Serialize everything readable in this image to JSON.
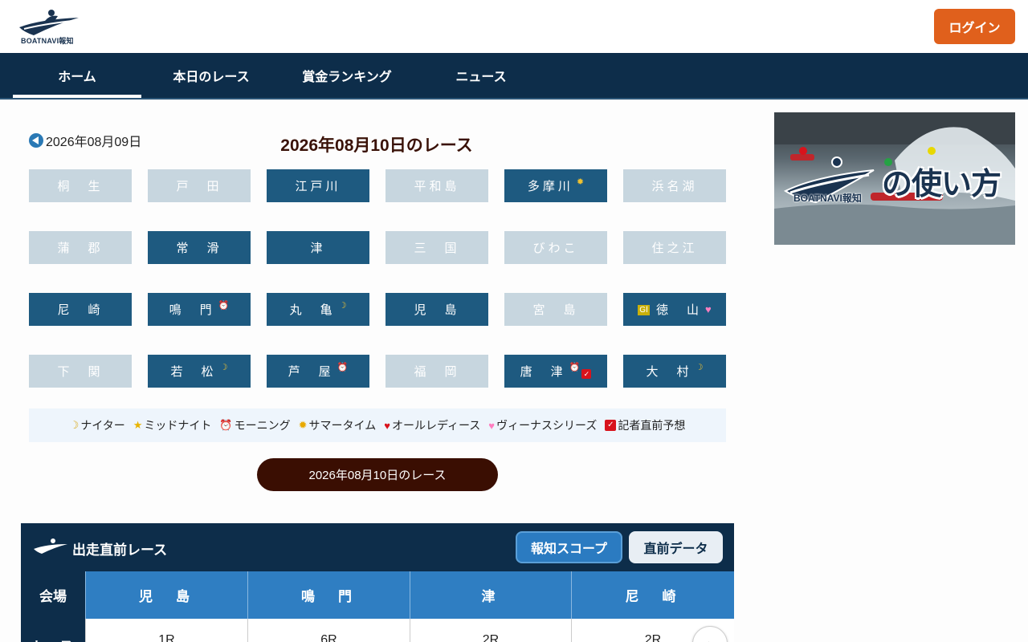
{
  "header": {
    "logo_text": "BOATNAVI報知",
    "login_label": "ログイン"
  },
  "nav": {
    "items": [
      {
        "label": "ホーム",
        "active": true
      },
      {
        "label": "本日のレース",
        "active": false
      },
      {
        "label": "賞金ランキング",
        "active": false
      },
      {
        "label": "ニュース",
        "active": false
      }
    ]
  },
  "date_nav": {
    "prev_date": "2026年08月09日",
    "title": "2026年08月10日のレース"
  },
  "venues": [
    {
      "name": "桐　生",
      "active": false
    },
    {
      "name": "戸　田",
      "active": false
    },
    {
      "name": "江戸川",
      "active": true
    },
    {
      "name": "平和島",
      "active": false
    },
    {
      "name": "多摩川",
      "active": true,
      "marks": [
        "summertime"
      ]
    },
    {
      "name": "浜名湖",
      "active": false
    },
    {
      "name": "蒲　郡",
      "active": false
    },
    {
      "name": "常　滑",
      "active": true
    },
    {
      "name": "津",
      "active": true
    },
    {
      "name": "三　国",
      "active": false
    },
    {
      "name": "びわこ",
      "active": false
    },
    {
      "name": "住之江",
      "active": false
    },
    {
      "name": "尼　崎",
      "active": true
    },
    {
      "name": "鳴　門",
      "active": true,
      "marks": [
        "morning"
      ]
    },
    {
      "name": "丸　亀",
      "active": true,
      "marks": [
        "nighter"
      ]
    },
    {
      "name": "児　島",
      "active": true
    },
    {
      "name": "宮　島",
      "active": false
    },
    {
      "name": "徳　山",
      "active": true,
      "grade": "GⅠ",
      "marks": [
        "venus"
      ]
    },
    {
      "name": "下　関",
      "active": false
    },
    {
      "name": "若　松",
      "active": true,
      "marks": [
        "nighter"
      ]
    },
    {
      "name": "芦　屋",
      "active": true,
      "marks": [
        "morning"
      ]
    },
    {
      "name": "福　岡",
      "active": false
    },
    {
      "name": "唐　津",
      "active": true,
      "marks": [
        "morning",
        "reporter"
      ]
    },
    {
      "name": "大　村",
      "active": true,
      "marks": [
        "nighter"
      ]
    }
  ],
  "legend": {
    "nighter": "ナイター",
    "midnight": "ミッドナイト",
    "morning": "モーニング",
    "summertime": "サマータイム",
    "ladies": "オールレディース",
    "venus": "ヴィーナスシリーズ",
    "reporter": "記者直前予想"
  },
  "race_button": "2026年08月10日のレース",
  "upcoming": {
    "title": "出走直前レース",
    "scope_label": "報知スコープ",
    "direct_label": "直前データ",
    "venue_header": "会場",
    "race_header": "レース",
    "columns": [
      {
        "venue": "児　島",
        "race": "1R"
      },
      {
        "venue": "鳴　門",
        "race": "6R"
      },
      {
        "venue": "津",
        "race": "2R"
      },
      {
        "venue": "尼　崎",
        "race": "2R"
      }
    ]
  },
  "banner": {
    "headline": "の使い方",
    "logo_text": "BOATNAVI報知"
  },
  "icons": {
    "nighter": "crescent-moon-icon",
    "midnight": "star-icon",
    "morning": "alarm-clock-icon",
    "summertime": "sun-icon",
    "ladies": "red-heart-icon",
    "venus": "pink-heart-icon",
    "reporter": "check-box-icon"
  },
  "colors": {
    "nav_bg": "#0d2d4a",
    "venue_active": "#1e5a80",
    "venue_inactive": "#c7d6df",
    "login": "#e0601c",
    "race_button": "#3a0e02",
    "venue_column": "#2f7ec2"
  }
}
